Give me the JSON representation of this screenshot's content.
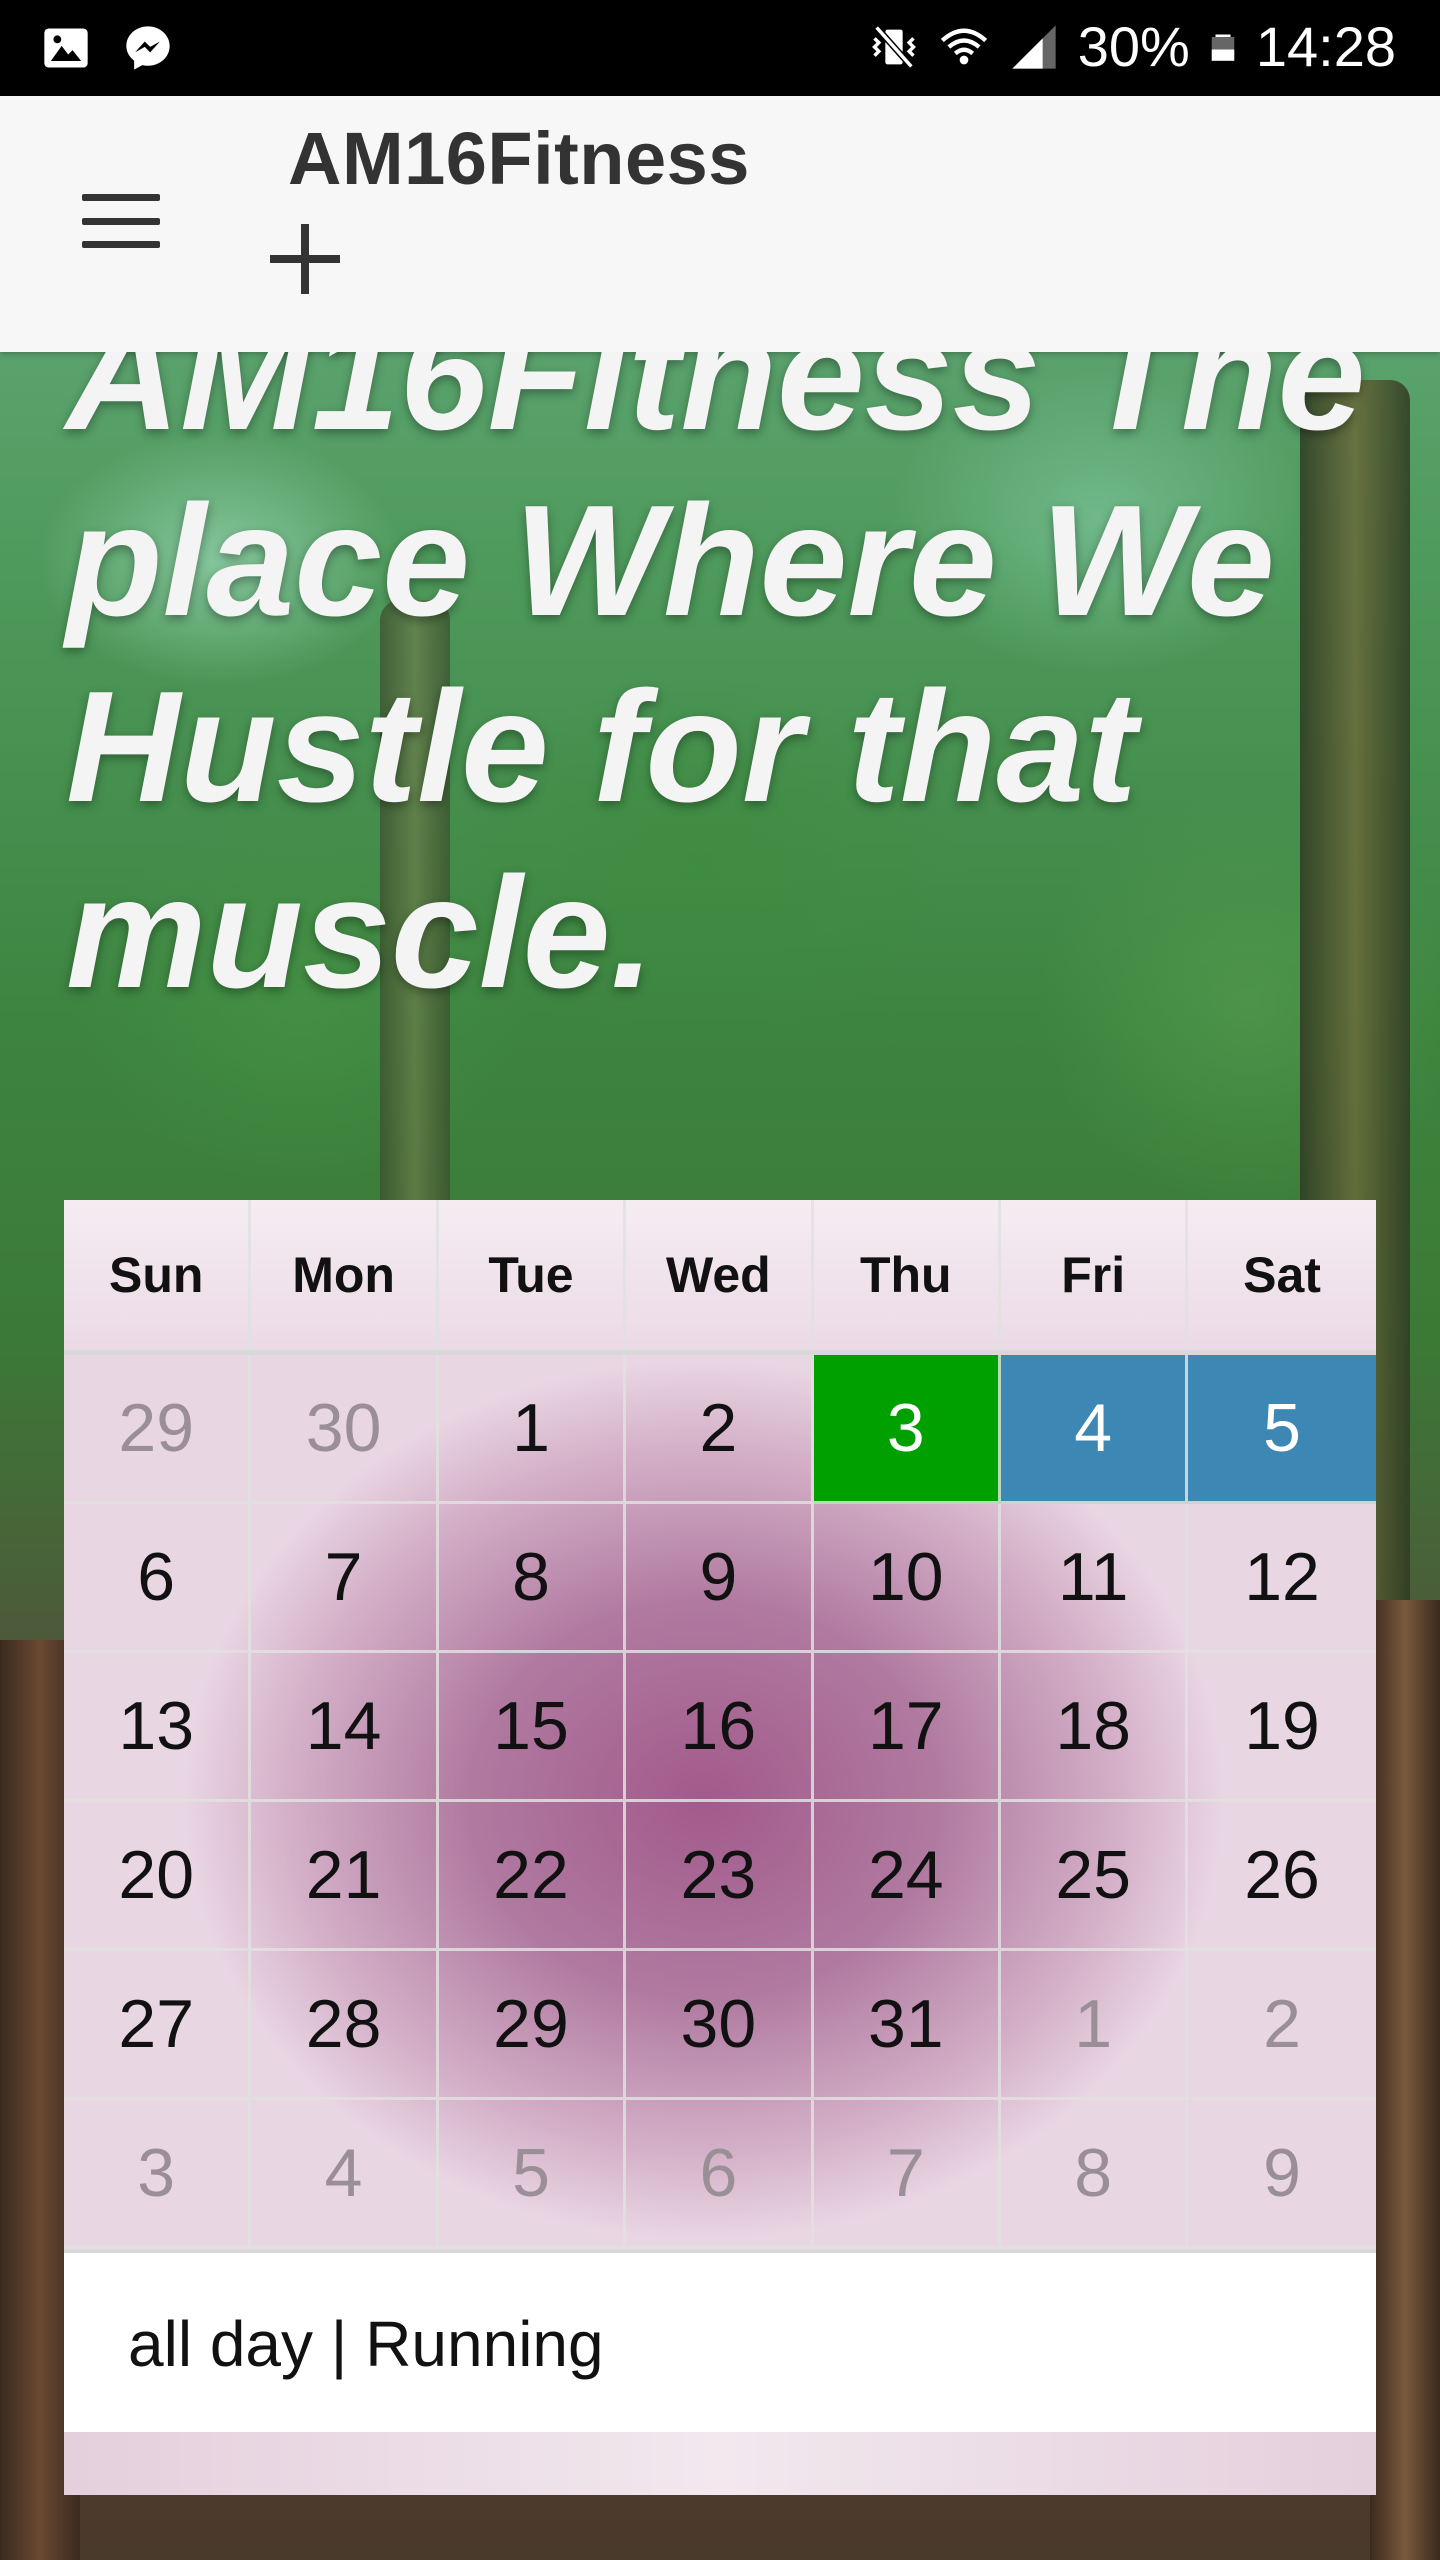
{
  "status_bar": {
    "battery": "30%",
    "time": "14:28",
    "left_icons": [
      "image-notification-icon",
      "messenger-icon"
    ],
    "right_icons": [
      "vibrate-mute-icon",
      "wifi-icon",
      "signal-icon",
      "battery-icon"
    ]
  },
  "app_bar": {
    "title": "AM16Fitness",
    "menu_icon": "menu-icon",
    "add_icon": "plus-icon"
  },
  "hero": {
    "heading": "AM16Fitness The place Where We Hustle for that muscle."
  },
  "calendar": {
    "weekdays": [
      "Sun",
      "Mon",
      "Tue",
      "Wed",
      "Thu",
      "Fri",
      "Sat"
    ],
    "weeks": [
      [
        {
          "day": "29",
          "other": true
        },
        {
          "day": "30",
          "other": true
        },
        {
          "day": "1"
        },
        {
          "day": "2"
        },
        {
          "day": "3",
          "state": "today"
        },
        {
          "day": "4",
          "state": "selected"
        },
        {
          "day": "5",
          "state": "selected"
        }
      ],
      [
        {
          "day": "6"
        },
        {
          "day": "7"
        },
        {
          "day": "8"
        },
        {
          "day": "9"
        },
        {
          "day": "10"
        },
        {
          "day": "11"
        },
        {
          "day": "12"
        }
      ],
      [
        {
          "day": "13"
        },
        {
          "day": "14"
        },
        {
          "day": "15"
        },
        {
          "day": "16"
        },
        {
          "day": "17"
        },
        {
          "day": "18"
        },
        {
          "day": "19"
        }
      ],
      [
        {
          "day": "20"
        },
        {
          "day": "21"
        },
        {
          "day": "22"
        },
        {
          "day": "23"
        },
        {
          "day": "24"
        },
        {
          "day": "25"
        },
        {
          "day": "26"
        }
      ],
      [
        {
          "day": "27"
        },
        {
          "day": "28"
        },
        {
          "day": "29"
        },
        {
          "day": "30"
        },
        {
          "day": "31"
        },
        {
          "day": "1",
          "other": true
        },
        {
          "day": "2",
          "other": true
        }
      ],
      [
        {
          "day": "3",
          "other": true
        },
        {
          "day": "4",
          "other": true
        },
        {
          "day": "5",
          "other": true
        },
        {
          "day": "6",
          "other": true
        },
        {
          "day": "7",
          "other": true
        },
        {
          "day": "8",
          "other": true
        },
        {
          "day": "9",
          "other": true
        }
      ]
    ],
    "colors": {
      "today": "#00a000",
      "selected": "#3c87b4"
    },
    "event": "all day | Running"
  }
}
